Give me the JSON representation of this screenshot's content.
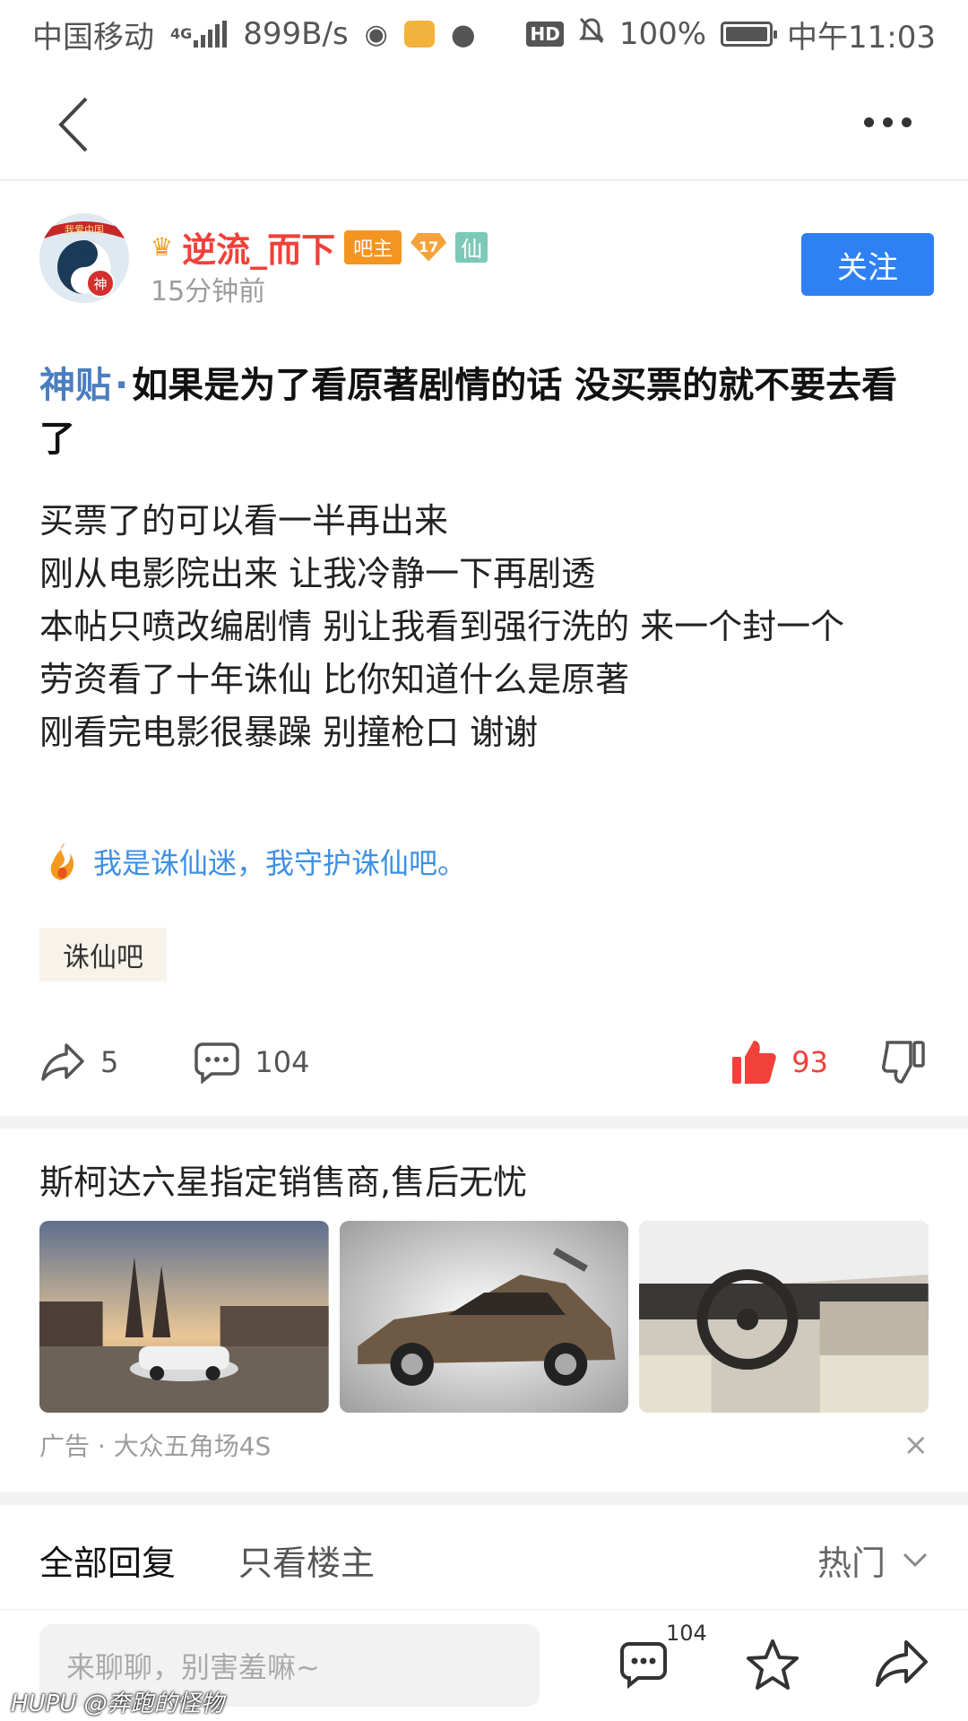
{
  "status_bar": {
    "carrier": "中国移动",
    "network": "4G",
    "speed": "899B/s",
    "hd": "HD",
    "battery": "100%",
    "time": "中午11:03"
  },
  "author": {
    "name": "逆流_而下",
    "owner_badge": "吧主",
    "level": "17",
    "xian_badge": "仙",
    "time": "15分钟前",
    "follow_label": "关注",
    "avatar_top_text": "我爱中国",
    "avatar_badge": "神"
  },
  "post": {
    "tag": "神贴",
    "tag_dot": "·",
    "title": "如果是为了看原著剧情的话 没买票的就不要去看了",
    "lines": [
      "买票了的可以看一半再出来",
      "刚从电影院出来 让我冷静一下再剧透",
      "本帖只喷改编剧情 别让我看到强行洗的 来一个封一个",
      "劳资看了十年诛仙 比你知道什么是原著",
      "刚看完电影很暴躁 别撞枪口 谢谢"
    ],
    "signature": "我是诛仙迷，我守护诛仙吧。",
    "forum_tag": "诛仙吧"
  },
  "actions": {
    "share_count": "5",
    "comment_count": "104",
    "like_count": "93"
  },
  "ad": {
    "title": "斯柯达六星指定销售商,售后无忧",
    "footer": "广告 · 大众五角场4S",
    "close": "×"
  },
  "replies": {
    "tab_all": "全部回复",
    "tab_owner": "只看楼主",
    "sort_label": "热门"
  },
  "bottom_bar": {
    "input_placeholder": "来聊聊，别害羞嘛~",
    "comment_badge": "104"
  },
  "watermark": "HUPU @奔跑的怪物",
  "colors": {
    "accent_blue": "#2f80f2",
    "like_red": "#f2403a",
    "author_red": "#f2403a",
    "tag_blue": "#4a7ec0"
  }
}
